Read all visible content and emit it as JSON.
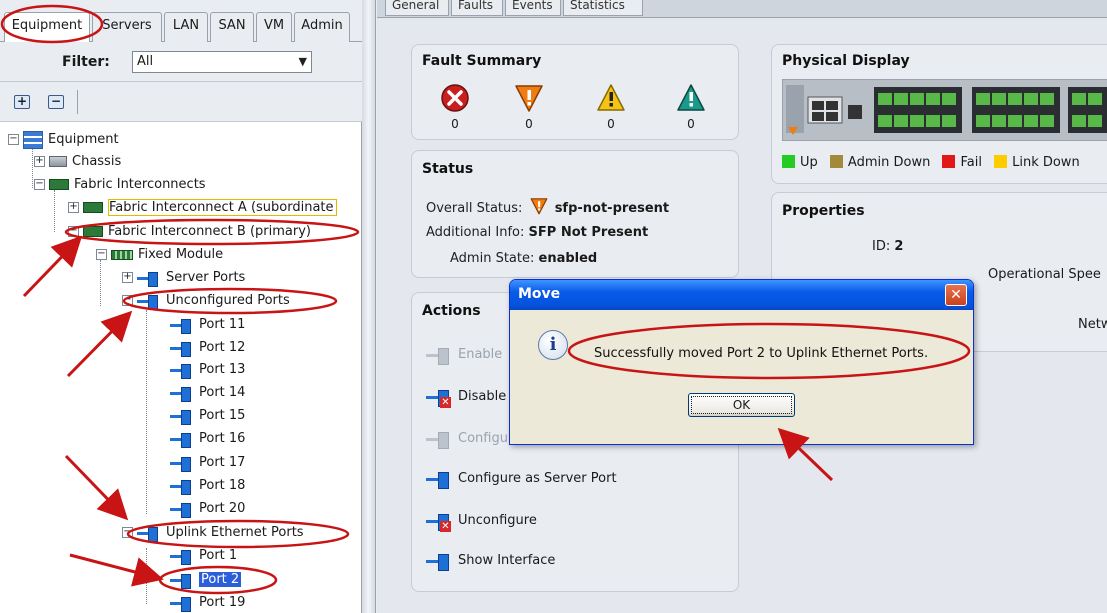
{
  "nav": {
    "tabs": [
      "Equipment",
      "Servers",
      "LAN",
      "SAN",
      "VM",
      "Admin"
    ],
    "filter_label": "Filter:",
    "filter_value": "All",
    "expand_all": "+",
    "collapse_all": "−",
    "tree": {
      "root": "Equipment",
      "chassis": "Chassis",
      "fabric_interconnects": "Fabric Interconnects",
      "fi_a": "Fabric Interconnect A (subordinate",
      "fi_b": "Fabric Interconnect B (primary)",
      "fixed_module": "Fixed Module",
      "server_ports": "Server Ports",
      "unconfigured_ports": "Unconfigured Ports",
      "unconfigured_list": [
        "Port 11",
        "Port 12",
        "Port 13",
        "Port 14",
        "Port 15",
        "Port 16",
        "Port 17",
        "Port 18",
        "Port 20"
      ],
      "uplink_ports": "Uplink Ethernet Ports",
      "uplink_list": [
        "Port 1",
        "Port 2",
        "Port 19"
      ]
    }
  },
  "content": {
    "tabs": [
      "General",
      "Faults",
      "Events",
      "Statistics"
    ],
    "fault_summary": {
      "title": "Fault Summary",
      "counts": [
        "0",
        "0",
        "0",
        "0"
      ]
    },
    "status": {
      "title": "Status",
      "overall_label": "Overall Status:",
      "overall_value": "sfp-not-present",
      "additional_label": "Additional Info:",
      "additional_value": "SFP Not Present",
      "admin_label": "Admin State:",
      "admin_value": "enabled"
    },
    "actions": {
      "title": "Actions",
      "items": [
        "Enable",
        "Disable",
        "Configure",
        "Configure as Server Port",
        "Unconfigure",
        "Show Interface"
      ]
    },
    "physical_display": {
      "title": "Physical Display",
      "legend": [
        "Up",
        "Admin Down",
        "Fail",
        "Link Down"
      ],
      "legend_colors": [
        "#22cc22",
        "#a38a3a",
        "#e01818",
        "#ffcc00"
      ]
    },
    "properties": {
      "title": "Properties",
      "id_label": "ID:",
      "id_value": "2",
      "op_speed_label": "Operational Spee",
      "network_label": "Netwo"
    }
  },
  "dialog": {
    "title": "Move",
    "message": "Successfully moved Port 2 to Uplink Ethernet Ports.",
    "ok_label": "OK",
    "close_label": "✕"
  },
  "annotation_color": "#d01010"
}
